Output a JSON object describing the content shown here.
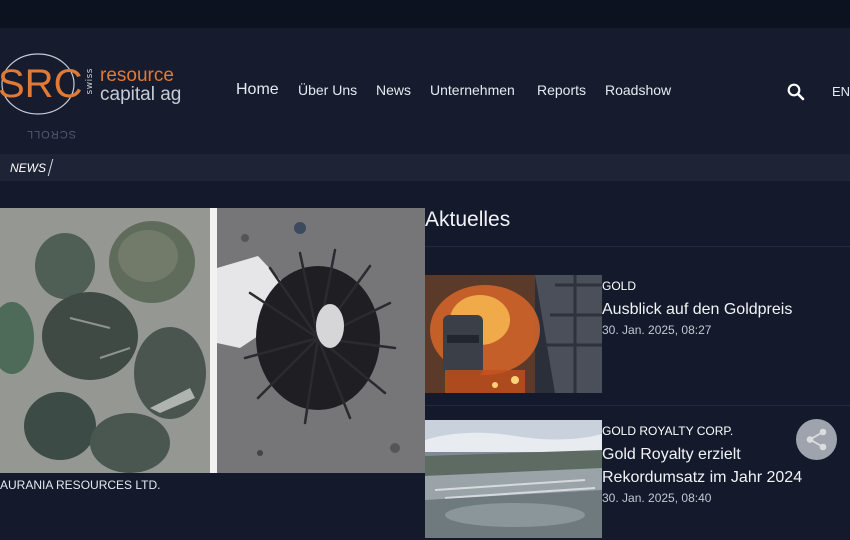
{
  "brand": {
    "logo_letters": "SRC",
    "logo_swiss": "swiss",
    "logo_line1": "resource",
    "logo_line2": "capital ag",
    "scroll_label": "SCROLL",
    "accent_color": "#e07a35"
  },
  "nav": {
    "items": [
      {
        "label": "Home",
        "active": true
      },
      {
        "label": "Über Uns",
        "active": false
      },
      {
        "label": "News",
        "active": false
      },
      {
        "label": "Unternehmen",
        "active": false
      },
      {
        "label": "Reports",
        "active": false
      },
      {
        "label": "Roadshow",
        "active": false
      }
    ],
    "search_icon": "search-icon",
    "language": "EN"
  },
  "ticker": {
    "label": "NEWS"
  },
  "featured": {
    "company": "AURANIA RESOURCES LTD."
  },
  "section": {
    "title": "Aktuelles"
  },
  "news": [
    {
      "category": "GOLD",
      "title": "Ausblick auf den Goldpreis",
      "date": "30. Jan. 2025, 08:27"
    },
    {
      "category": "GOLD ROYALTY CORP.",
      "title": "Gold Royalty erzielt Rekordumsatz im Jahr 2024",
      "date": "30. Jan. 2025, 08:40"
    }
  ],
  "share": {
    "icon": "share-icon"
  }
}
